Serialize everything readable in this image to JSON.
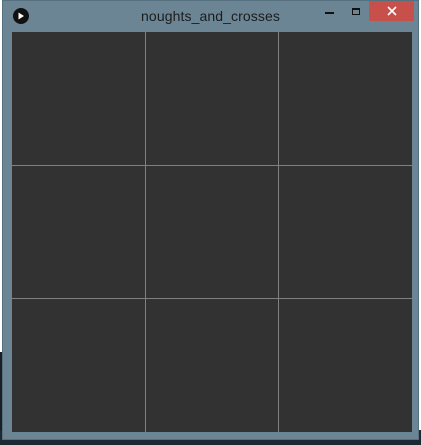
{
  "window": {
    "title": "noughts_and_crosses",
    "controls": {
      "minimize_icon": "minimize-icon",
      "maximize_icon": "maximize-icon",
      "close_icon": "close-icon"
    }
  },
  "board": {
    "rows": 3,
    "cols": 3,
    "cells": [
      "",
      "",
      "",
      "",
      "",
      "",
      "",
      "",
      ""
    ],
    "background_color": "#323232",
    "line_color": "#808080"
  },
  "colors": {
    "frame": "#6b8594",
    "close_button": "#c7504b"
  }
}
